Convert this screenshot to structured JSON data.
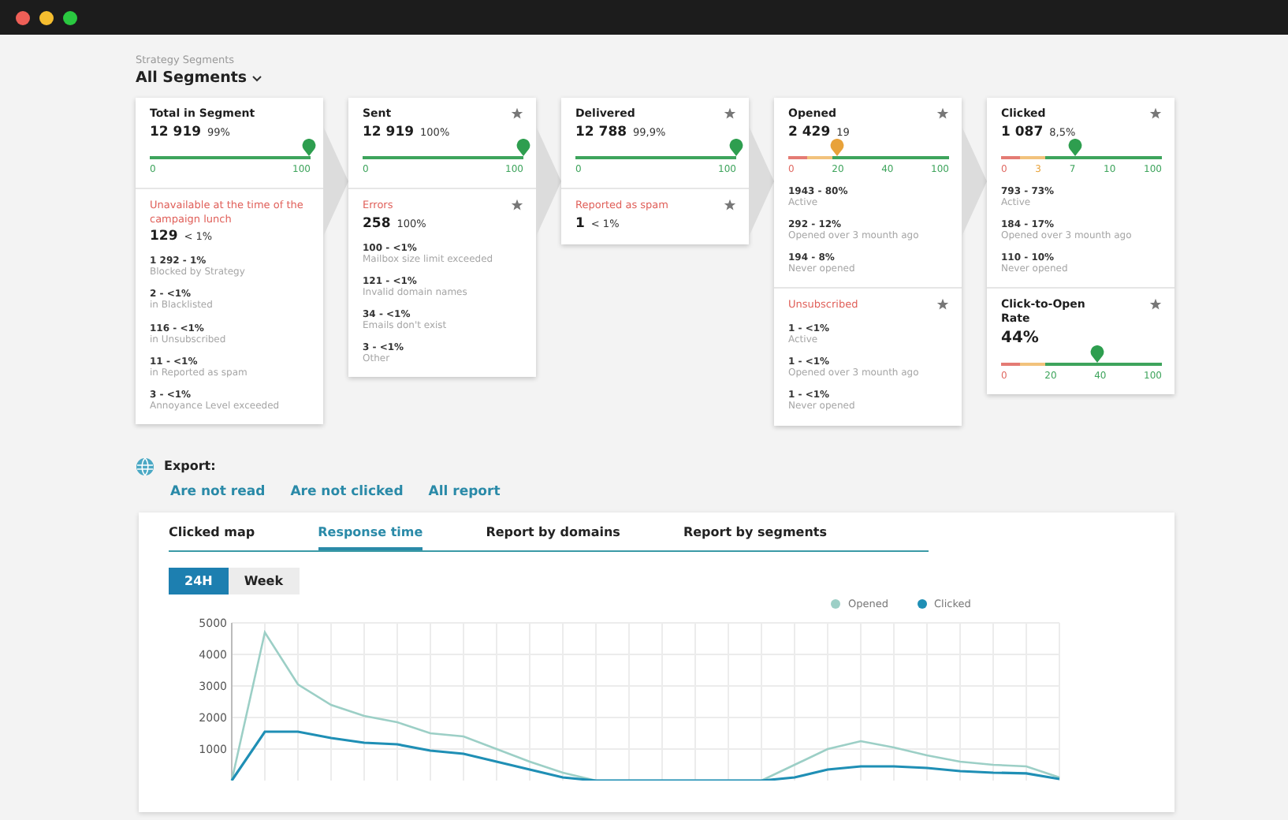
{
  "header": {
    "caption": "Strategy Segments",
    "selector": "All Segments"
  },
  "funnel": [
    {
      "title": "Total in Segment",
      "value": "12 919",
      "percent": "99%",
      "pin": false,
      "gauge": {
        "level": 0.99,
        "kind": "plain",
        "color": "#2e9e4f",
        "ticks": [
          "0",
          "100"
        ]
      },
      "sections": [
        {
          "kind": "alert",
          "title": "Unavailable at the time of the campaign lunch",
          "pin": false,
          "value": "129",
          "percent": "< 1%",
          "items": [
            {
              "count": "1 292 - 1%",
              "label": "Blocked by Strategy"
            },
            {
              "count": "2 - <1%",
              "label": "in Blacklisted"
            },
            {
              "count": "116 - <1%",
              "label": "in Unsubscribed"
            },
            {
              "count": "11 - <1%",
              "label": "in Reported as spam"
            },
            {
              "count": "3 - <1%",
              "label": "Annoyance Level exceeded"
            }
          ]
        }
      ]
    },
    {
      "title": "Sent",
      "value": "12 919",
      "percent": "100%",
      "pin": true,
      "gauge": {
        "level": 1,
        "kind": "plain",
        "color": "#2e9e4f",
        "ticks": [
          "0",
          "100"
        ]
      },
      "sections": [
        {
          "kind": "alert",
          "title": "Errors",
          "pin": true,
          "value": "258",
          "percent": "100%",
          "items": [
            {
              "count": "100 - <1%",
              "label": "Mailbox size limit exceeded"
            },
            {
              "count": "121 - <1%",
              "label": "Invalid domain names"
            },
            {
              "count": "34 - <1%",
              "label": "Emails don't exist"
            },
            {
              "count": "3 - <1%",
              "label": "Other"
            }
          ]
        }
      ]
    },
    {
      "title": "Delivered",
      "value": "12 788",
      "percent": "99,9%",
      "pin": true,
      "gauge": {
        "level": 0.999,
        "kind": "plain",
        "color": "#2e9e4f",
        "ticks": [
          "0",
          "100"
        ]
      },
      "sections": [
        {
          "kind": "alert",
          "title": "Reported as spam",
          "pin": true,
          "value": "1",
          "percent": "< 1%"
        }
      ]
    },
    {
      "title": "Opened",
      "value": "2 429",
      "percent": "19",
      "pin": true,
      "gauge": {
        "level": 0.3,
        "kind": "graded",
        "color": "#e8a23a",
        "ticks": [
          "0",
          "20",
          "40",
          "100"
        ]
      },
      "items": [
        {
          "count": "1943 - 80%",
          "label": "Active"
        },
        {
          "count": "292 - 12%",
          "label": "Opened over 3 mounth ago"
        },
        {
          "count": "194 - 8%",
          "label": "Never opened"
        }
      ],
      "sections": [
        {
          "kind": "alert",
          "title": "Unsubscribed",
          "pin": true,
          "items": [
            {
              "count": "1 - <1%",
              "label": "Active"
            },
            {
              "count": "1 - <1%",
              "label": "Opened over 3 mounth ago"
            },
            {
              "count": "1 - <1%",
              "label": "Never opened"
            }
          ]
        }
      ]
    },
    {
      "title": "Clicked",
      "value": "1 087",
      "percent": "8,5%",
      "pin": true,
      "gauge": {
        "level": 0.46,
        "kind": "graded",
        "color": "#2e9e4f",
        "ticks": [
          "0",
          "3",
          "7",
          "10",
          "100"
        ]
      },
      "items": [
        {
          "count": "793 - 73%",
          "label": "Active"
        },
        {
          "count": "184 - 17%",
          "label": "Opened over 3 mounth ago"
        },
        {
          "count": "110 - 10%",
          "label": "Never opened"
        }
      ],
      "sections": [
        {
          "kind": "metric",
          "title": "Click-to-Open Rate",
          "pin": true,
          "value": "44%",
          "gauge": {
            "level": 0.6,
            "kind": "graded",
            "color": "#2e9e4f",
            "ticks": [
              "0",
              "20",
              "40",
              "100"
            ]
          }
        }
      ]
    }
  ],
  "export": {
    "label": "Export:",
    "links": [
      "Are not read",
      "Are not clicked",
      "All report"
    ]
  },
  "tabs": [
    {
      "label": "Clicked map",
      "selected": false
    },
    {
      "label": "Response time",
      "selected": true
    },
    {
      "label": "Report by domains",
      "selected": false
    },
    {
      "label": "Report by segments",
      "selected": false
    }
  ],
  "range": [
    {
      "label": "24H",
      "selected": true
    },
    {
      "label": "Week",
      "selected": false
    }
  ],
  "chart_data": {
    "type": "line",
    "grid": true,
    "ylim": [
      0,
      5000
    ],
    "yticks": [
      1000,
      2000,
      3000,
      4000,
      5000
    ],
    "series": [
      {
        "name": "Opened",
        "color": "#9ccfc6",
        "values": [
          0,
          4700,
          3050,
          2400,
          2050,
          1850,
          1500,
          1400,
          1000,
          600,
          250,
          0,
          0,
          0,
          0,
          0,
          0,
          500,
          1000,
          1250,
          1050,
          800,
          600,
          500,
          450,
          100
        ]
      },
      {
        "name": "Clicked",
        "color": "#1f8fb5",
        "values": [
          0,
          1550,
          1550,
          1350,
          1200,
          1150,
          950,
          850,
          600,
          350,
          100,
          0,
          0,
          0,
          0,
          0,
          0,
          100,
          350,
          450,
          450,
          400,
          300,
          250,
          230,
          50
        ]
      }
    ]
  }
}
